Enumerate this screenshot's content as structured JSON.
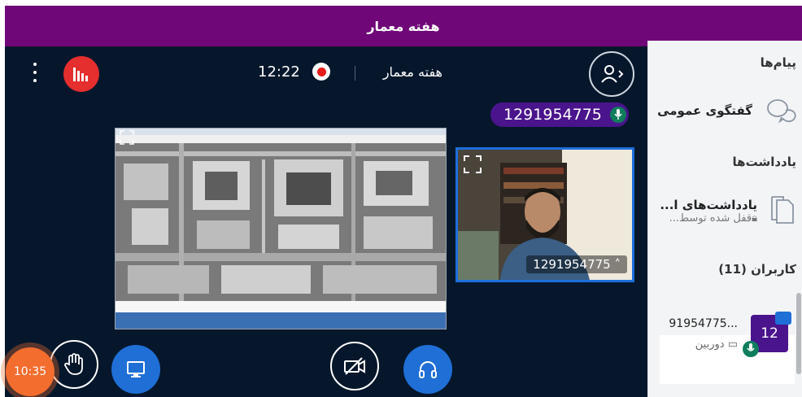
{
  "app": {
    "title": "هفته معمار"
  },
  "header": {
    "meeting_title": "هفته معمار",
    "timer": "12:22"
  },
  "talker": {
    "label": "1291954775"
  },
  "webcam": {
    "name": "1291954775"
  },
  "badge": {
    "time": "10:35"
  },
  "sidebar": {
    "messages_heading": "پیام‌ها",
    "public_chat": "گفتگوی عمومی",
    "notes_heading": "یادداشت‌ها",
    "shared_notes": "یادداشت‌های ا...",
    "notes_locked": "قفل شده توسط...",
    "users_heading": "کاربران (11)",
    "user_name": "...91954775",
    "user_status": "دوربین",
    "avatar_text": "12"
  },
  "colors": {
    "brand": "#6f0778",
    "main_bg": "#06172c",
    "accent": "#1f6fd6",
    "talker": "#4a148c",
    "record": "#e81b1b",
    "timer_badge": "#f26d2e"
  },
  "icons": [
    "menu-dots-icon",
    "activity-icon",
    "record-icon",
    "user-toggle-icon",
    "mic-icon",
    "expand-icon",
    "hand-icon",
    "screen-share-icon",
    "camera-off-icon",
    "headphones-icon",
    "chat-icon",
    "notes-icon",
    "lock-icon",
    "camera-icon",
    "presenter-icon"
  ]
}
